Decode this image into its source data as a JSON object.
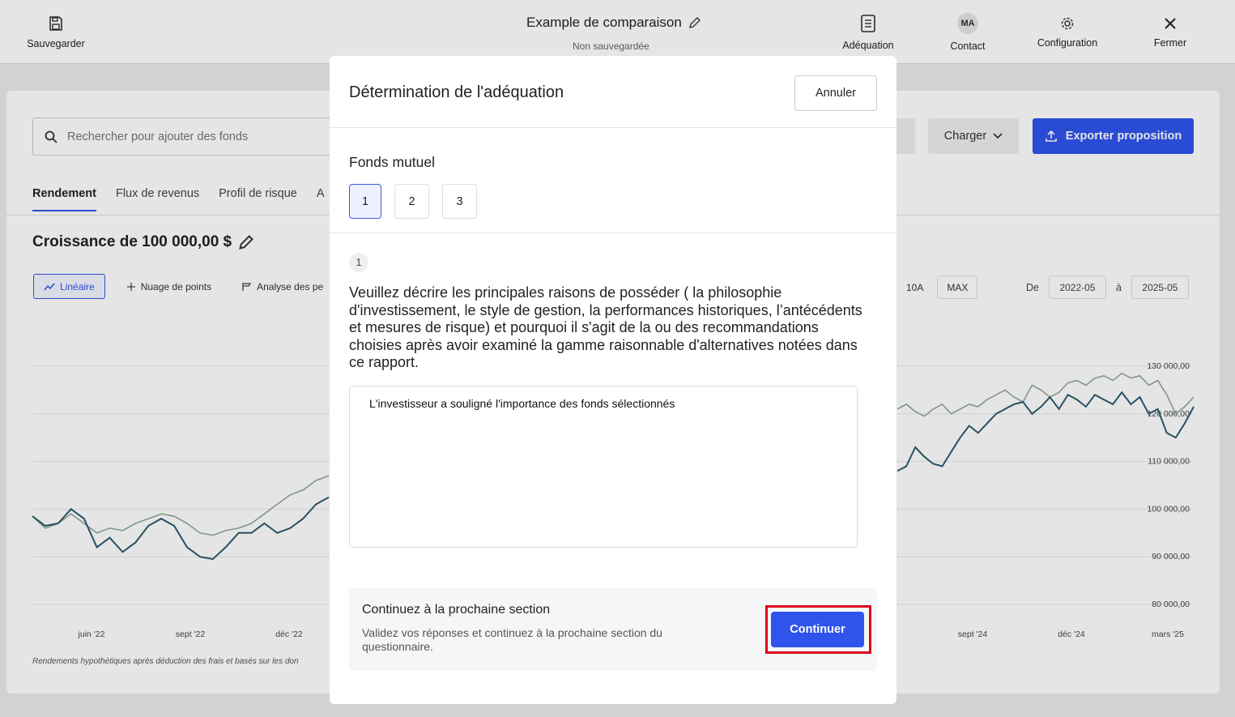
{
  "topbar": {
    "save_label": "Sauvegarder",
    "doc_title": "Example de comparaison",
    "doc_status": "Non sauvegardée",
    "adequation_label": "Adéquation",
    "contact_initials": "MA",
    "contact_label": "Contact",
    "config_label": "Configuration",
    "close_label": "Fermer"
  },
  "main": {
    "search_placeholder": "Rechercher pour ajouter des fonds",
    "charger_label": "Charger",
    "export_label": "Exporter proposition",
    "tabs": [
      "Rendement",
      "Flux de revenus",
      "Profil de risque",
      "A"
    ],
    "growth_title": "Croissance de 100 000,00 $",
    "chart_types": [
      "Linéaire",
      "Nuage de points",
      "Analyse des pe"
    ],
    "ranges": [
      "10A",
      "MAX"
    ],
    "date_from_label": "De",
    "date_from": "2022-05",
    "date_to_label": "à",
    "date_to": "2025-05",
    "footnote": "Rendements hypothétiques après déduction des frais et basés sur les don"
  },
  "chart_data": {
    "type": "line",
    "x_ticks": [
      "juin '22",
      "sept '22",
      "déc '22",
      "sept '24",
      "déc '24",
      "mars '25"
    ],
    "y_ticks": [
      "130 000,00",
      "120 000,00",
      "110 000,00",
      "100 000,00",
      "90 000,00",
      "80 000,00"
    ],
    "ylim": [
      80000,
      130000
    ],
    "series": [
      {
        "values": [
          98500,
          96000,
          97000,
          99000,
          97000,
          95000,
          96000,
          95500,
          97000,
          98000,
          99000,
          98500,
          97000,
          95000,
          94500,
          95500,
          96000,
          97000,
          99000,
          101000,
          103000,
          104000,
          106000,
          107000
        ]
      },
      {
        "values": [
          98500,
          96500,
          97000,
          100000,
          98000,
          92000,
          94000,
          91000,
          93000,
          96500,
          98000,
          96500,
          92000,
          90000,
          89500,
          92000,
          95000,
          95000,
          97000,
          95000,
          96000,
          98000,
          101000,
          102500
        ]
      }
    ]
  },
  "modal": {
    "title": "Détermination de l'adéquation",
    "cancel_label": "Annuler",
    "section_title": "Fonds mutuel",
    "steps": [
      "1",
      "2",
      "3"
    ],
    "question_number": "1",
    "question": "Veuillez décrire les principales raisons de posséder ( la philosophie d'investissement, le style de gestion, la performances historiques, l’antécédents et mesures de risque) et pourquoi il s'agit de la ou des recommandations choisies après avoir examiné la gamme raisonnable d'alternatives notées dans ce rapport.",
    "answer": "L'investisseur a souligné l'importance des fonds sélectionnés",
    "next_title": "Continuez à la prochaine section",
    "next_desc": "Validez vos réponses et continuez à la prochaine section du questionnaire.",
    "continue_label": "Continuer"
  },
  "colors": {
    "accent": "#2f54eb",
    "highlight": "#e0001b",
    "series_dark": "#2d5a6e",
    "series_light": "#8fa89a"
  }
}
